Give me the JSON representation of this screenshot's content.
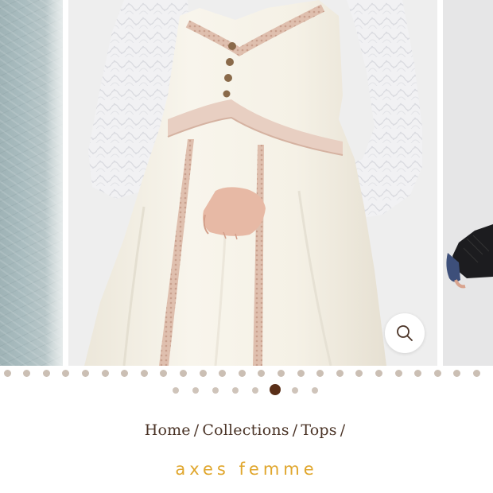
{
  "carousel": {
    "slides": [
      {
        "name": "previous-slide",
        "description": "pale blue lace jacket"
      },
      {
        "name": "current-slide",
        "description": "cream dress with white lace sleeves and pink lace trim"
      },
      {
        "name": "next-slide",
        "description": "black lace glove"
      }
    ],
    "zoom_icon": "magnifier-icon",
    "pagination": {
      "count": 8,
      "active_index": 5
    }
  },
  "breadcrumb": {
    "items": [
      "Home",
      "Collections",
      "Tops"
    ],
    "separator": "/"
  },
  "brand": {
    "name": "axes femme"
  },
  "colors": {
    "accent_text": "#4a3326",
    "brand_gold": "#e0a62c",
    "dot_inactive": "#cfc4ba",
    "dot_active": "#5a2f18"
  }
}
